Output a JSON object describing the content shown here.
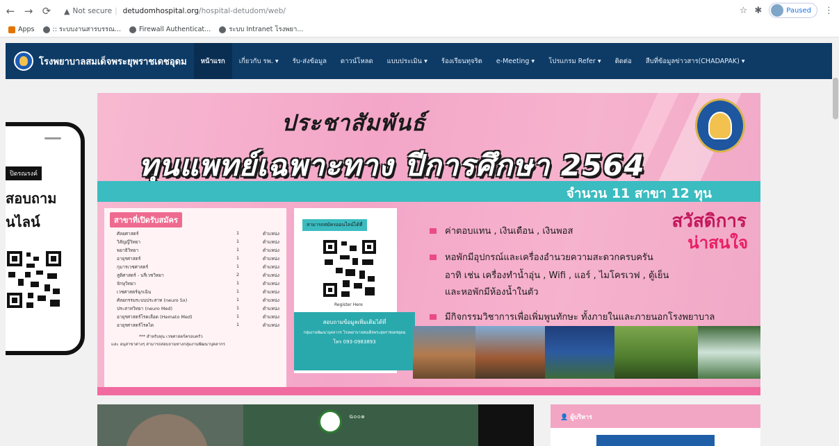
{
  "browser": {
    "nav": {
      "back": "←",
      "forward": "→",
      "reload": "⟳"
    },
    "omnibox": {
      "security": "Not secure",
      "host": "detudomhospital.org",
      "path": "/hospital-detudom/web/"
    },
    "profile_label": "Paused",
    "bookmarks": [
      {
        "label": "Apps",
        "color": "#e37400"
      },
      {
        "label": ":: ระบบงานสารบรรณ...",
        "color": "#5f6368"
      },
      {
        "label": "Firewall Authenticat...",
        "color": "#5f6368"
      },
      {
        "label": "ระบบ Intranet โรงพยา...",
        "color": "#5f6368"
      }
    ]
  },
  "site": {
    "title": "โรงพยาบาลสมเด็จพระยุพราชเดชอุดม",
    "menu": [
      {
        "label": "หน้าแรก",
        "active": true
      },
      {
        "label": "เกี่ยวกับ รพ. ▾",
        "active": false
      },
      {
        "label": "รับ-ส่งข้อมูล",
        "active": false
      },
      {
        "label": "ดาวน์โหลด",
        "active": false
      },
      {
        "label": "แบบประเมิน ▾",
        "active": false
      },
      {
        "label": "ร้องเรียนทุจริต",
        "active": false
      },
      {
        "label": "e-Meeting ▾",
        "active": false
      },
      {
        "label": "โปรแกรม Refer ▾",
        "active": false
      },
      {
        "label": "ติดต่อ",
        "active": false
      },
      {
        "label": "สืบที่ข้อมูลข่าวสาร(CHADAPAK) ▾",
        "active": false
      }
    ]
  },
  "phone": {
    "tag": "ปิดรณรงค์",
    "line1": "สอบถาม",
    "line2": "นไลน์"
  },
  "banner": {
    "pr_title": "ประชาสัมพันธ์",
    "main_title": "ทุนแพทย์เฉพาะทาง ปีการศึกษา 2564",
    "count_text": "จำนวน 11 สาขา 12 ทุน",
    "left_header": "สาขาที่เปิดรับสมัคร",
    "branches": [
      {
        "name": "ศัลยศาสตร์",
        "count": "1",
        "unit": "ตำแหน่ง"
      },
      {
        "name": "วิสัญญีวิทยา",
        "count": "1",
        "unit": "ตำแหน่ง"
      },
      {
        "name": "พยาธิวิทยา",
        "count": "1",
        "unit": "ตำแหน่ง"
      },
      {
        "name": "อายุรศาสตร์",
        "count": "1",
        "unit": "ตำแหน่ง"
      },
      {
        "name": "กุมารเวชศาสตร์",
        "count": "1",
        "unit": "ตำแหน่ง"
      },
      {
        "name": "สูติศาสตร์ - นรีเวชวิทยา",
        "count": "2",
        "unit": "ตำแหน่ง"
      },
      {
        "name": "จักษุวิทยา",
        "count": "1",
        "unit": "ตำแหน่ง"
      },
      {
        "name": "เวชศาสตร์ฉุกเฉิน",
        "count": "1",
        "unit": "ตำแหน่ง"
      },
      {
        "name": "ศัลยกรรมระบบประสาท (neuro Sx)",
        "count": "1",
        "unit": "ตำแหน่ง"
      },
      {
        "name": "ประสาทวิทยา (neuro Med)",
        "count": "1",
        "unit": "ตำแหน่ง"
      },
      {
        "name": "อายุรศาสตร์โรคเลือด (Hemato Med)",
        "count": "1",
        "unit": "ตำแหน่ง"
      },
      {
        "name": "อายุรศาสตร์โรคไต",
        "count": "1",
        "unit": "ตำแหน่ง"
      }
    ],
    "left_footnote1": "*** สำหรับทุน เวชศาสตร์ครอบครัว",
    "left_footnote2": "และ อนุสาขาต่างๆ สามารถสอบถามทางกลุ่มงานพัฒนาบุคลากร",
    "mid_tag": "สามารถสมัครออนไลน์ได้ที่",
    "mid_reg": "Register Here",
    "contact_title": "สอบถามข้อมูลเพิ่มเติมได้ที่",
    "contact_line": "กลุ่มงานพัฒนาบุคลากร โรงพยาบาลสมเด็จพระยุพราชเดชอุดม",
    "contact_tel": "โทร 093-0983893",
    "bullets": [
      "ค่าตอบแทน , เงินเดือน , เงินพอส",
      "หอพักมีอุปกรณ์และเครื่องอำนวยความสะดวกครบครัน"
    ],
    "bullet2_cont1": "อาทิ เช่น เครื่องทำน้ำอุ่น , Wifi , แอร์ , ไมโครเวฟ , ตู้เย็น",
    "bullet2_cont2": "และหอพักมีห้องน้ำในตัว",
    "bullet3": "มีกิจกรรมวิชาการเพื่อเพิ่มพูนทักษะ ทั้งภายในและภายนอกโรงพยาบาล",
    "welfare1": "สวัสดิการ",
    "welfare2": "น่าสนใจ"
  },
  "cards": {
    "left_text": "ฉ๐๐๑",
    "right_title": "ผู้บริหาร"
  },
  "colors": {
    "nav_bg": "#0d3b66",
    "banner_pink": "#f4a6c8",
    "teal": "#3bbcc0",
    "accent_pink": "#e94b86"
  }
}
